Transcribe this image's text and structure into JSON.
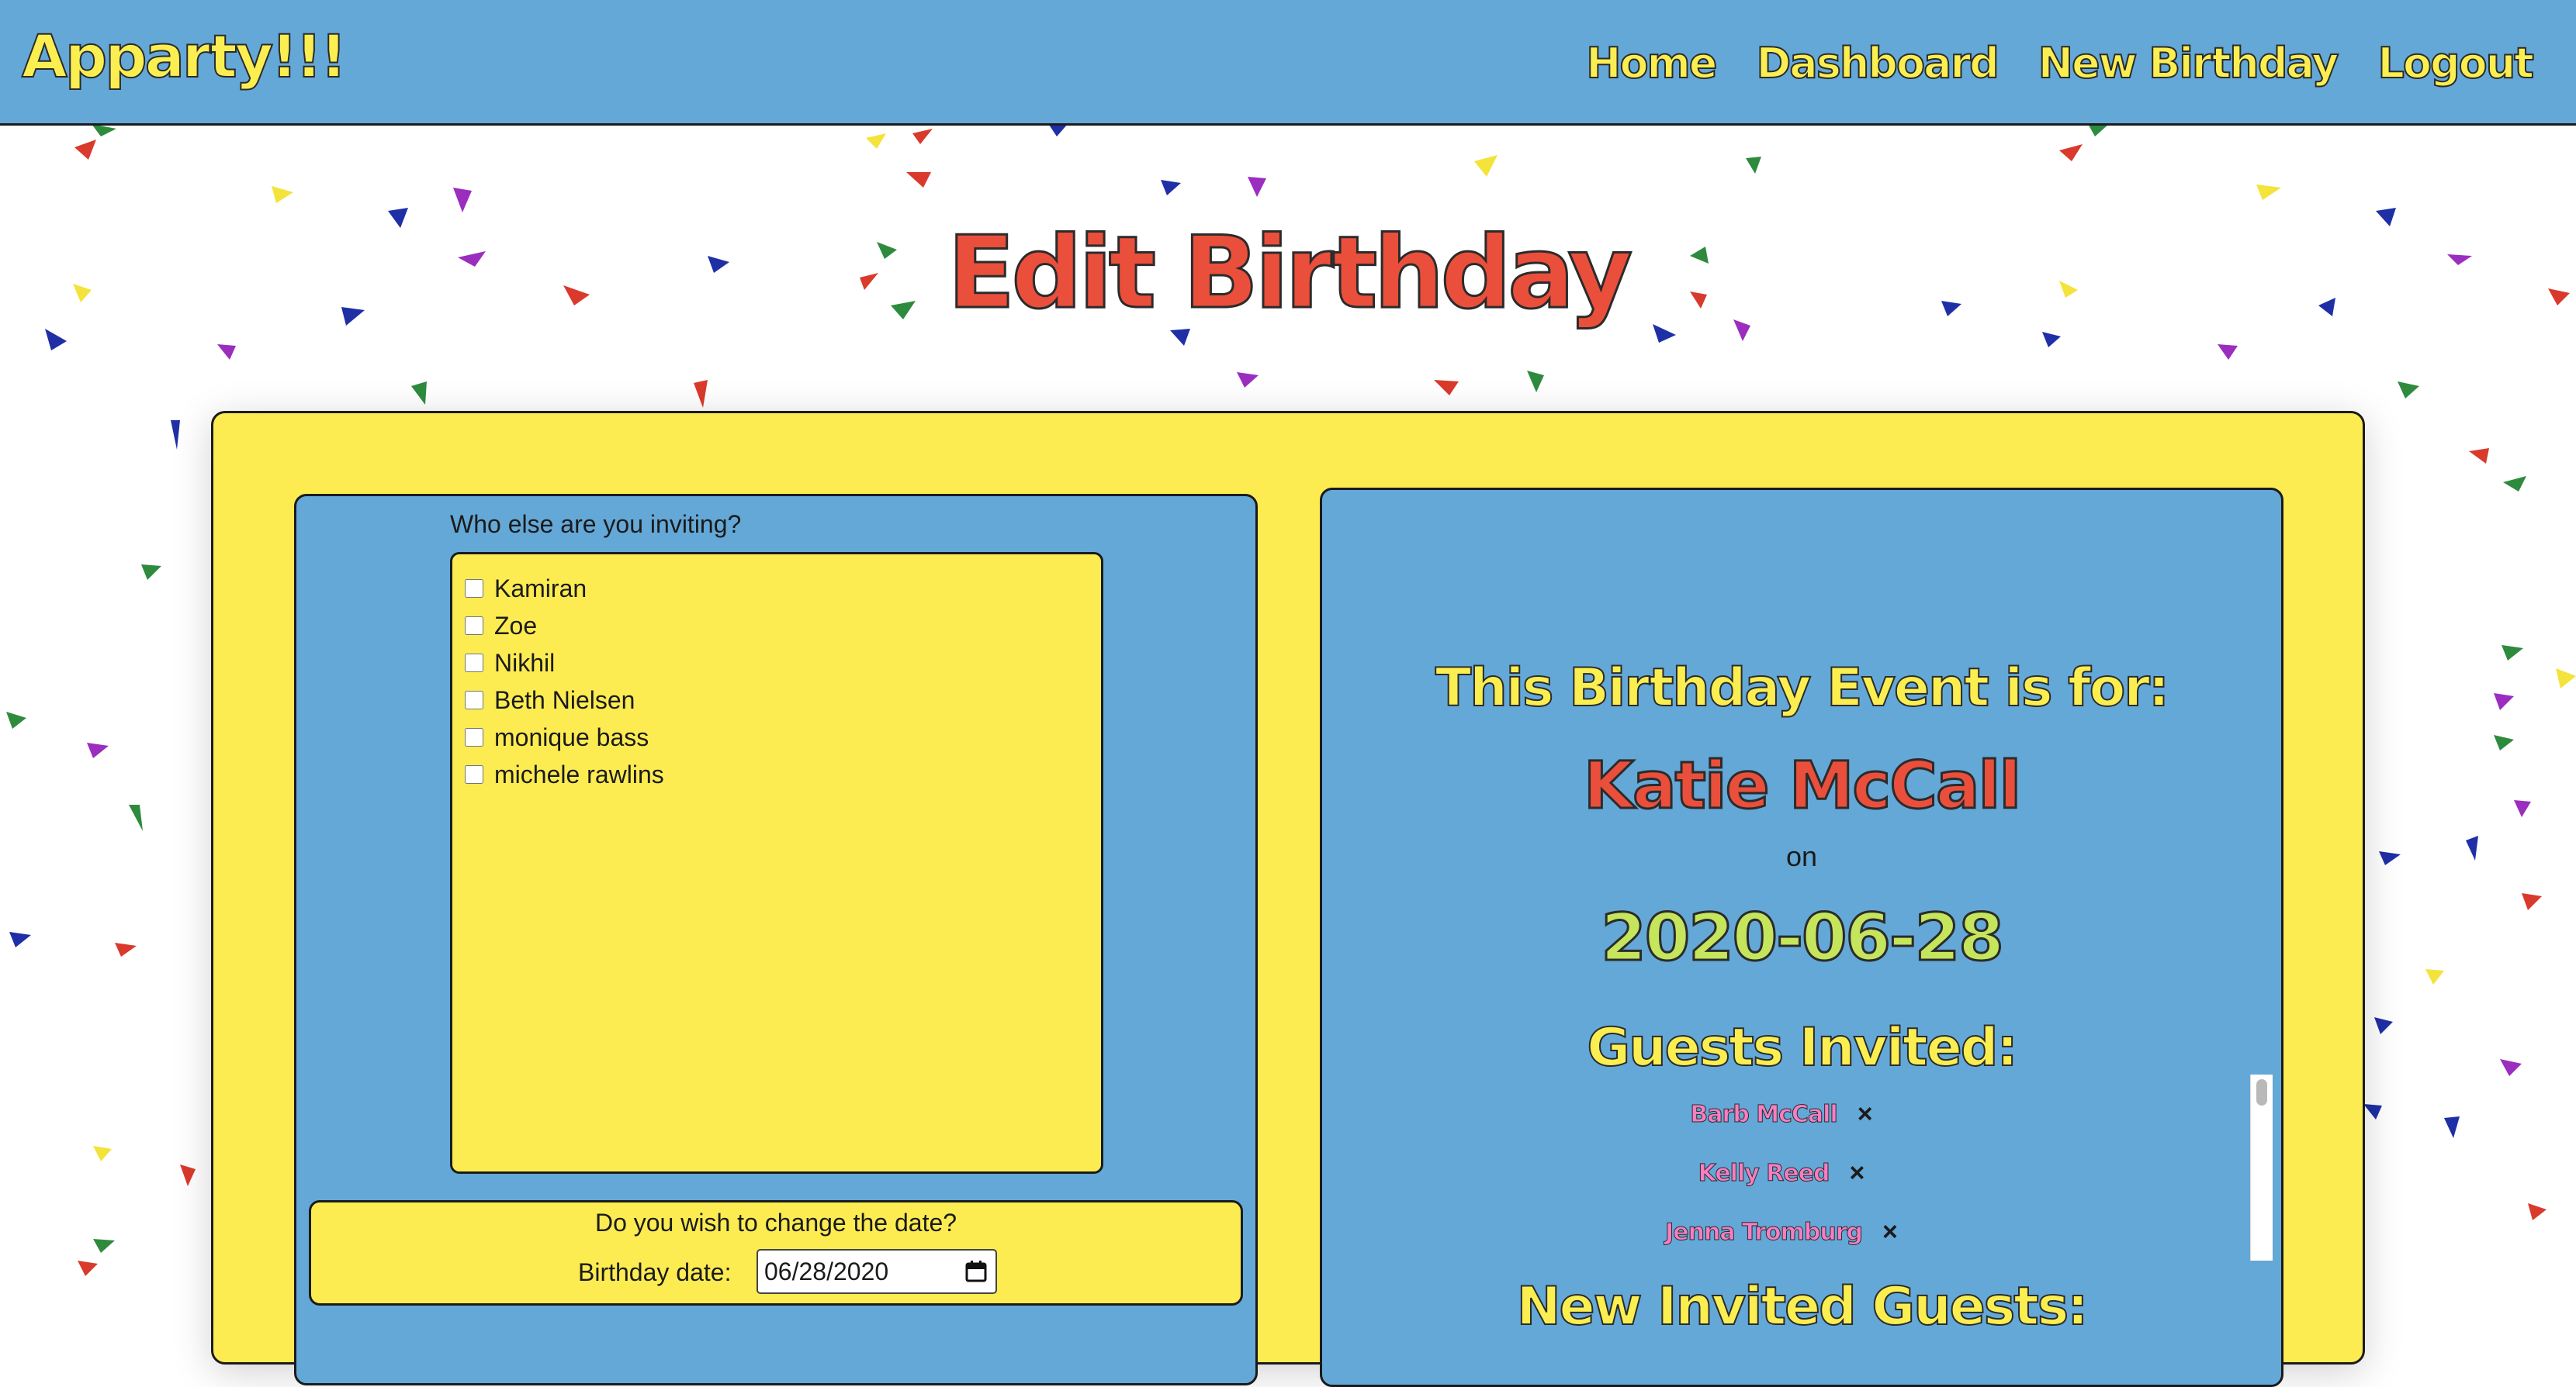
{
  "navbar": {
    "brand": "Apparty!!!",
    "links": [
      "Home",
      "Dashboard",
      "New Birthday",
      "Logout"
    ]
  },
  "page": {
    "title": "Edit Birthday"
  },
  "invite_form": {
    "label": "Who else are you inviting?",
    "guests": [
      "Kamiran",
      "Zoe",
      "Nikhil",
      "Beth Nielsen",
      "monique bass",
      "michele rawlins"
    ]
  },
  "date_form": {
    "question": "Do you wish to change the date?",
    "label": "Birthday date:",
    "value": "06/28/2020"
  },
  "event": {
    "heading": "This Birthday Event is for:",
    "person": "Katie McCall",
    "on": "on",
    "date": "2020-06-28",
    "guests_heading": "Guests Invited:",
    "guests": [
      "Barb McCall",
      "Kelly Reed",
      "Jenna Tromburg"
    ],
    "remove_symbol": "×",
    "new_guests_heading": "New Invited Guests:"
  },
  "colors": {
    "nav_blue": "#64a8d7",
    "yellow": "#fcec52",
    "title_red": "#ea4f3c",
    "date_green": "#c4e55c",
    "guest_pink": "#f77ec2"
  }
}
